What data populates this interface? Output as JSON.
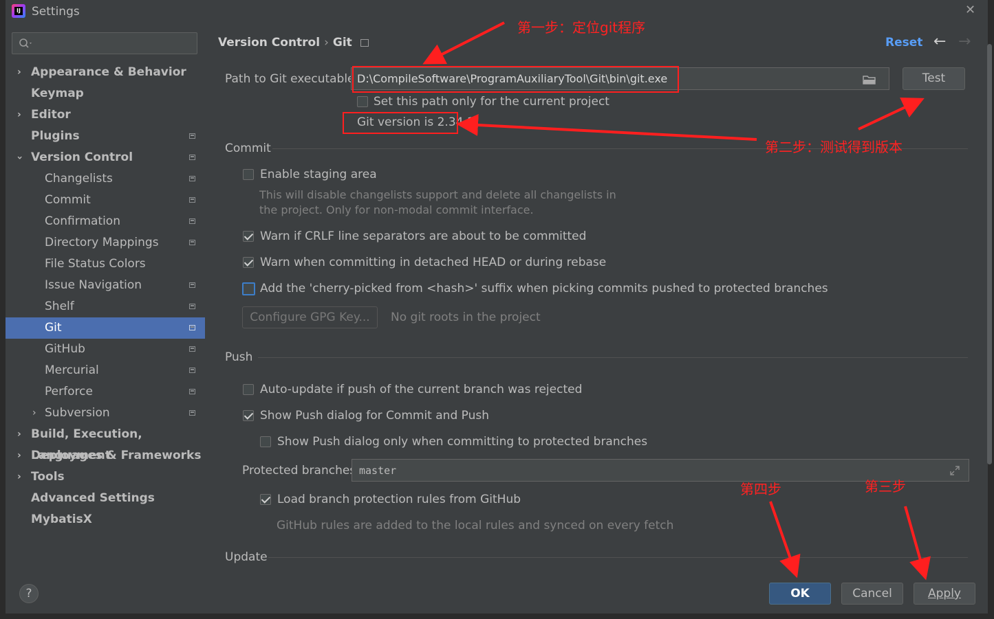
{
  "window": {
    "title": "Settings"
  },
  "sidebar": {
    "search_placeholder": "",
    "items": [
      {
        "label": "Appearance & Behavior"
      },
      {
        "label": "Keymap"
      },
      {
        "label": "Editor"
      },
      {
        "label": "Plugins"
      },
      {
        "label": "Version Control"
      },
      {
        "label": "Changelists"
      },
      {
        "label": "Commit"
      },
      {
        "label": "Confirmation"
      },
      {
        "label": "Directory Mappings"
      },
      {
        "label": "File Status Colors"
      },
      {
        "label": "Issue Navigation"
      },
      {
        "label": "Shelf"
      },
      {
        "label": "Git"
      },
      {
        "label": "GitHub"
      },
      {
        "label": "Mercurial"
      },
      {
        "label": "Perforce"
      },
      {
        "label": "Subversion"
      },
      {
        "label": "Build, Execution, Deployment"
      },
      {
        "label": "Languages & Frameworks"
      },
      {
        "label": "Tools"
      },
      {
        "label": "Advanced Settings"
      },
      {
        "label": "MybatisX"
      }
    ],
    "selected": "Git"
  },
  "header": {
    "breadcrumb_parent": "Version Control",
    "breadcrumb_separator": "›",
    "breadcrumb_current": "Git",
    "reset_label": "Reset",
    "back_glyph": "←",
    "forward_glyph": "→"
  },
  "git_path": {
    "label": "Path to Git executable:",
    "value": "D:\\CompileSoftware\\ProgramAuxiliaryTool\\Git\\bin\\git.exe",
    "test_label": "Test",
    "project_only_label": "Set this path only for the current project",
    "version_text": "Git version is 2.34.1"
  },
  "commit": {
    "section_title": "Commit",
    "staging_label": "Enable staging area",
    "staging_hint_1": "This will disable changelists support and delete all changelists in",
    "staging_hint_2": "the project. Only for non-modal commit interface.",
    "crlf_label": "Warn if CRLF line separators are about to be committed",
    "detached_label": "Warn when committing in detached HEAD or during rebase",
    "cherry_label": "Add the 'cherry-picked from <hash>' suffix when picking commits pushed to protected branches",
    "gpg_button": "Configure GPG Key...",
    "gpg_hint": "No git roots in the project"
  },
  "push": {
    "section_title": "Push",
    "auto_update_label": "Auto-update if push of the current branch was rejected",
    "show_dialog_label": "Show Push dialog for Commit and Push",
    "protected_only_label": "Show Push dialog only when committing to protected branches",
    "protected_branches_label": "Protected branches:",
    "protected_branches_value": "master",
    "load_rules_label": "Load branch protection rules from GitHub",
    "load_rules_hint": "GitHub rules are added to the local rules and synced on every fetch"
  },
  "update": {
    "section_title": "Update"
  },
  "footer": {
    "help_label": "?",
    "ok_label": "OK",
    "cancel_label": "Cancel",
    "apply_label": "Apply"
  },
  "annotations": {
    "step1": "第一步：定位git程序",
    "step2": "第二步：测试得到版本",
    "step3": "第三步",
    "step4": "第四步"
  },
  "colors": {
    "background": "#3c3f41",
    "selection": "#4b6eaf",
    "link": "#589df6",
    "annotation": "#ff1f1f",
    "primary_button": "#365880"
  }
}
